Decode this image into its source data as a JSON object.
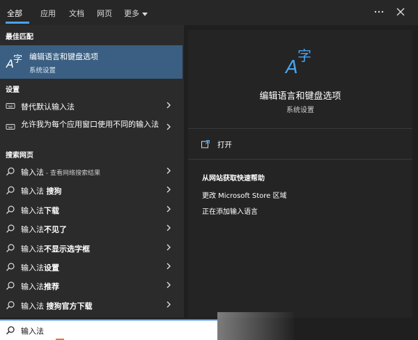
{
  "tabs": [
    {
      "label": "全部"
    },
    {
      "label": "应用"
    },
    {
      "label": "文档"
    },
    {
      "label": "网页"
    },
    {
      "label": "更多"
    }
  ],
  "top_icons": {
    "more": "more-options-icon",
    "close": "close-icon"
  },
  "best_match": {
    "heading": "最佳匹配",
    "title": "编辑语言和键盘选项",
    "subtitle": "系统设置",
    "icon": "language-settings-icon"
  },
  "settings": {
    "heading": "设置",
    "items": [
      {
        "label": "替代默认输入法"
      },
      {
        "label": "允许我为每个应用窗口使用不同的输入法"
      }
    ]
  },
  "web": {
    "heading": "搜索网页",
    "items": [
      {
        "prefix": "输入法",
        "suffix": " - 查看网络搜索结果"
      },
      {
        "prefix": "输入法 ",
        "suffix": "搜狗"
      },
      {
        "prefix": "输入法",
        "suffix": "下载"
      },
      {
        "prefix": "输入法",
        "suffix": "不见了"
      },
      {
        "prefix": "输入法",
        "suffix": "不显示选字框"
      },
      {
        "prefix": "输入法",
        "suffix": "设置"
      },
      {
        "prefix": "输入法",
        "suffix": "推荐"
      },
      {
        "prefix": "输入法 ",
        "suffix": "搜狗官方下载"
      }
    ]
  },
  "preview": {
    "title": "编辑语言和键盘选项",
    "subtitle": "系统设置",
    "open_label": "打开",
    "help_heading": "从网站获取快速帮助",
    "help_links": [
      {
        "label": "更改 Microsoft Store 区域"
      },
      {
        "label": "正在添加输入语言"
      }
    ]
  },
  "search": {
    "value": "输入法"
  },
  "colors": {
    "accent": "#4aa3f0",
    "selected": "#3a5f82"
  }
}
